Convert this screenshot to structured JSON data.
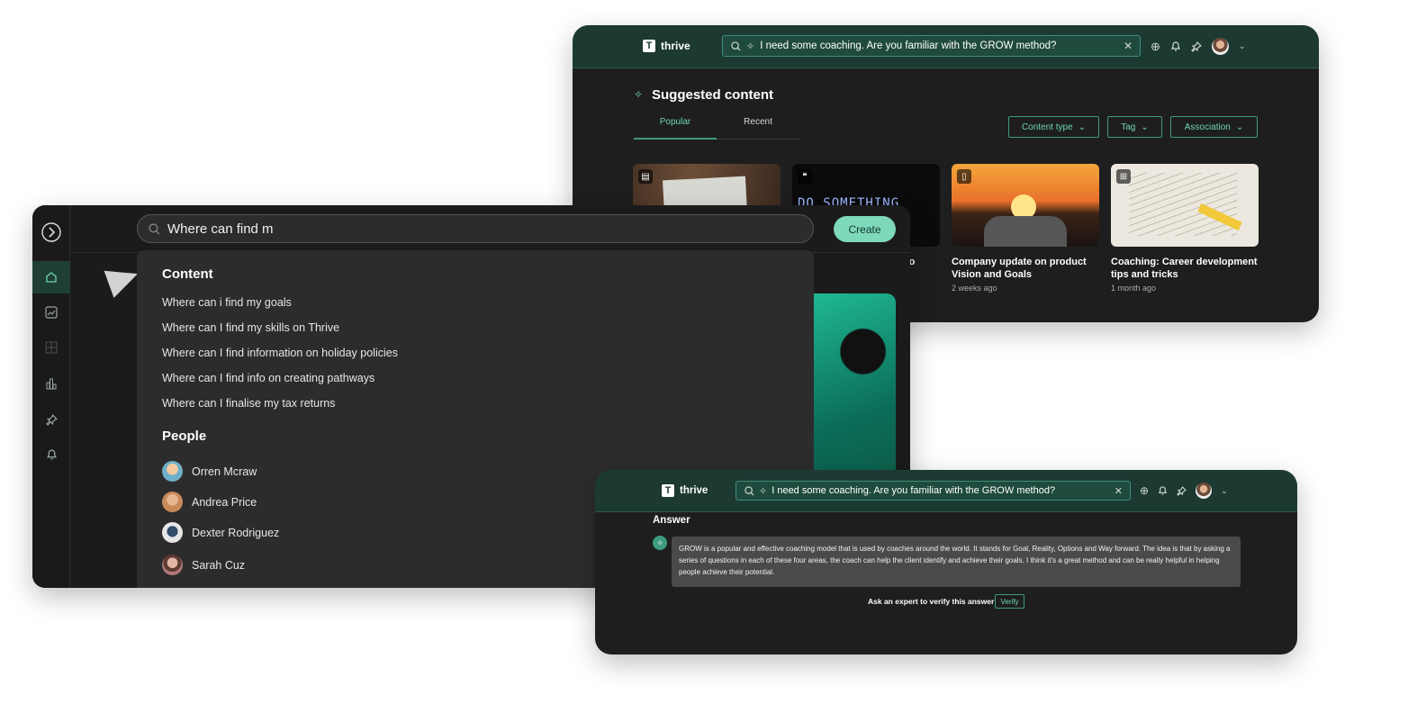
{
  "window_a": {
    "brand": "thrive",
    "logo_letter": "T",
    "query": "I need some coaching. Are you familiar with the GROW method?",
    "section_title": "Suggested content",
    "tabs": [
      {
        "label": "Popular",
        "active": true
      },
      {
        "label": "Recent",
        "active": false
      }
    ],
    "filters": [
      "Content type",
      "Tag",
      "Association"
    ],
    "cards": [
      {
        "badge": "film-icon",
        "title": "",
        "meta": ""
      },
      {
        "badge": "quote-icon",
        "title": "to",
        "meta": ""
      },
      {
        "badge": "document-icon",
        "title": "Company update on product Vision and Goals",
        "meta": "2 weeks ago"
      },
      {
        "badge": "id-icon",
        "title": "Coaching: Career development tips and tricks",
        "meta": "1 month ago"
      }
    ],
    "card2_image_text": "DO SOMETHING GREAT"
  },
  "window_b": {
    "search_value": "Where can find m",
    "create_label": "Create",
    "content_heading": "Content",
    "suggestions": [
      "Where can i find my goals",
      "Where can I find my skills on Thrive",
      "Where can I find information on holiday policies",
      "Where can I find info on creating pathways",
      "Where can I finalise my tax returns"
    ],
    "people_heading": "People",
    "people": [
      {
        "name": "Orren Mcraw",
        "color": "#6fb0c9"
      },
      {
        "name": "Andrea Price",
        "color": "#c98a5a"
      },
      {
        "name": "Dexter Rodriguez",
        "color": "#e6e6e6"
      },
      {
        "name": "Sarah Cuz",
        "color": "#b07a78"
      }
    ],
    "sidebar_icons": [
      "chevron-right-icon",
      "home-icon",
      "growth-icon",
      "grid-icon",
      "bar-chart-icon",
      "pin-icon",
      "bell-icon"
    ]
  },
  "window_c": {
    "brand": "thrive",
    "logo_letter": "T",
    "query": "I need some coaching. Are you familiar with the GROW method?",
    "answer_heading": "Answer",
    "answer_text": "GROW is a popular and effective coaching model that is used by coaches around the world. It stands for Goal, Reality, Options and Way forward. The idea is that by asking a series of questions in each of these four areas, the coach can help the client identify and achieve their goals. I think it's a great method and can be really helpful in helping people achieve their potential.",
    "verify_prompt": "Ask an expert to verify this answer",
    "verify_label": "Verify"
  },
  "colors": {
    "accent": "#6cd4b3",
    "header": "#1c3932",
    "panel": "#1e1e1e",
    "create_button": "#7ed8bc"
  }
}
